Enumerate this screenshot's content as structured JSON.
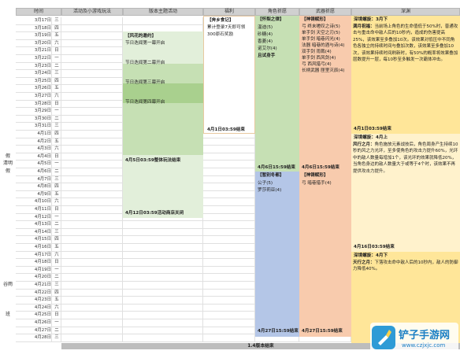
{
  "headers": [
    "时间",
    "活动及小游戏玩法",
    "版本主题活动",
    "福利",
    "角色祈愿",
    "武器祈愿",
    "深渊"
  ],
  "side_labels": [
    {
      "text": "假",
      "row": 21
    },
    {
      "text": "清明",
      "row": 22
    },
    {
      "text": "假",
      "row": 23
    },
    {
      "text": "谷雨",
      "row": 38
    },
    {
      "text": "班",
      "row": 42
    }
  ],
  "dates": [
    [
      "3月17日",
      "三"
    ],
    [
      "3月18日",
      "四"
    ],
    [
      "3月19日",
      "五"
    ],
    [
      "3月20日",
      "六"
    ],
    [
      "3月21日",
      "日"
    ],
    [
      "3月22日",
      "一"
    ],
    [
      "3月23日",
      "二"
    ],
    [
      "3月24日",
      "三"
    ],
    [
      "3月25日",
      "四"
    ],
    [
      "3月26日",
      "五"
    ],
    [
      "3月27日",
      "六"
    ],
    [
      "3月28日",
      "日"
    ],
    [
      "3月29日",
      "一"
    ],
    [
      "3月30日",
      "二"
    ],
    [
      "3月31日",
      "三"
    ],
    [
      "4月1日",
      "四"
    ],
    [
      "4月2日",
      "五"
    ],
    [
      "4月3日",
      "六"
    ],
    [
      "4月4日",
      "日"
    ],
    [
      "4月5日",
      "一"
    ],
    [
      "4月6日",
      "二"
    ],
    [
      "4月7日",
      "三"
    ],
    [
      "4月8日",
      "四"
    ],
    [
      "4月9日",
      "五"
    ],
    [
      "4月10日",
      "六"
    ],
    [
      "4月11日",
      "日"
    ],
    [
      "4月12日",
      "一"
    ],
    [
      "4月13日",
      "二"
    ],
    [
      "4月14日",
      "三"
    ],
    [
      "4月15日",
      "四"
    ],
    [
      "4月16日",
      "五"
    ],
    [
      "4月17日",
      "六"
    ],
    [
      "4月18日",
      "日"
    ],
    [
      "4月19日",
      "一"
    ],
    [
      "4月20日",
      "二"
    ],
    [
      "4月21日",
      "三"
    ],
    [
      "4月22日",
      "四"
    ],
    [
      "4月23日",
      "五"
    ],
    [
      "4月24日",
      "六"
    ],
    [
      "4月25日",
      "日"
    ],
    [
      "4月26日",
      "一"
    ],
    [
      "4月27日",
      "二"
    ],
    [
      "4月28日",
      "三"
    ]
  ],
  "theme_event": {
    "title": "【风花的邀约】",
    "lines": [
      "节日迭闻第一幕开启",
      "节日迭闻第二幕开启",
      "节日迭闻第三幕开启",
      "节日迭闻第四幕开启"
    ],
    "end1": "4月5日03:59整体玩法结束",
    "end2": "4月12日03:59活动商店关闭"
  },
  "welfare": {
    "title": "【奔乡食记】",
    "lines": [
      "累计登录7天即可领",
      "300原石奖励"
    ],
    "end": "4月1日03:59结束"
  },
  "char_banner_1": {
    "title": "【怀梨之律】",
    "lines": [
      "温迪(5)",
      "砂糖(4)",
      "香菱(4)",
      "诺艾尔(4)"
    ],
    "bold": "且试身手",
    "end": "4月6日15:59结束"
  },
  "char_banner_2": {
    "title": "【暂别冬都】",
    "lines": [
      "公子(5)",
      "罗莎莉亚(4)"
    ],
    "end": "4月27日15:59结束"
  },
  "weapon_banner_1": {
    "title": "【神铸赋形】",
    "lines": [
      "弓 终末嗟叹之诗(5)",
      "单手剑 天空之刃(5)",
      "单手剑 暗巷闪光(4)",
      "法器 暗巷的酒与诗(4)",
      "双手剑 雨裁(4)",
      "单手剑 西风剑(4)",
      "弓 西风猎弓(4)",
      "长柄武器 匣里灭辰(4)"
    ],
    "end": "4月6日15:59结束"
  },
  "weapon_banner_2": {
    "title": "【神铸赋形】",
    "lines": [
      "弓 暗巷猎手(4)"
    ],
    "end": "4月27日15:59结束"
  },
  "abyss_1": {
    "head": "深境螺旋：3月下",
    "name": "满月祝福：",
    "text": "当前场上角色的生命值低于50%时，普通攻击与重击命中敌人后的10秒内，造成的伤害提高25%，该效果至多叠加10次。该效果对低压中不同角色各独立的持续时间与叠加次数，该效果至多叠加10次，该效果持续时间刷新时，有50%的概率将效果叠加层数提升一层，每10秒至多触发一次霸体冲击。",
    "end": "4月1日03:59结束"
  },
  "abyss_2": {
    "head": "深境螺旋：4月上",
    "name": "风行之月：",
    "text": "角色施放元素战技后，角色周身产生持续10秒的风之力光环，至多使角色的攻击力提升60%，光环中的敌人数量每增加1个，该光环的效果就降低20%，当角色身边的敌人数量大于或等于4个时，该效果不再提供攻击力提升。",
    "end": "4月16日03:59结束"
  },
  "abyss_3": {
    "head": "深境螺旋：4月下",
    "name": "天行之月：",
    "text": "下落攻击命中敌人后的10秒内，敌人的防御力降低40%。"
  },
  "footer": "1.4版本结束",
  "watermark": {
    "title": "铲子手游网",
    "url": "www.czjxjc.com"
  },
  "colors": {
    "green_light": "#e2efda",
    "green_mid": "#c6e0b4",
    "green_dark": "#a9d08e",
    "char_green": "#c6e0b4",
    "char_blue": "#b4c6e7",
    "weapon_orange": "#f8cbad",
    "abyss_yellow": "#ffe699",
    "welfare_bg": "#ffffff"
  }
}
